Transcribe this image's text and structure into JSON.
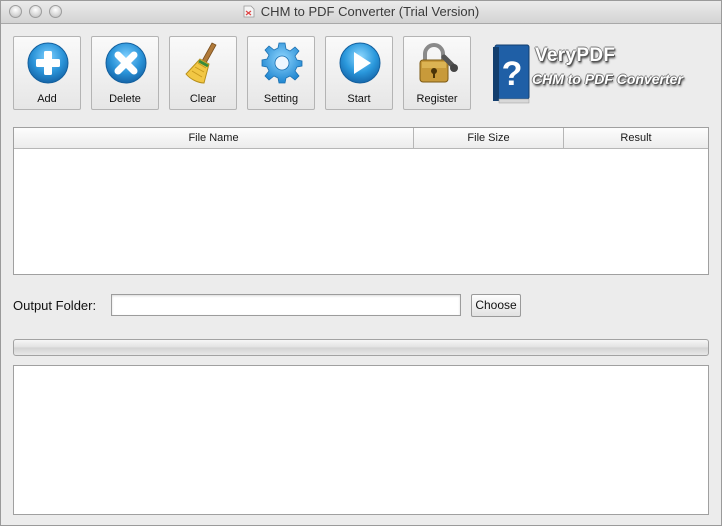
{
  "window": {
    "title": "CHM to PDF Converter (Trial Version)"
  },
  "toolbar": {
    "add_label": "Add",
    "delete_label": "Delete",
    "clear_label": "Clear",
    "setting_label": "Setting",
    "start_label": "Start",
    "register_label": "Register"
  },
  "logo": {
    "brand": "VeryPDF",
    "product": "CHM to PDF Converter"
  },
  "table": {
    "columns": [
      "File Name",
      "File Size",
      "Result"
    ],
    "rows": []
  },
  "output": {
    "label": "Output Folder:",
    "value": "",
    "choose_label": "Choose"
  },
  "progress": {
    "value": 0
  },
  "log": {
    "text": ""
  },
  "icons": {
    "add": "plus-circle-icon",
    "delete": "x-circle-icon",
    "clear": "broom-icon",
    "setting": "gear-icon",
    "start": "play-icon",
    "register": "padlock-key-icon"
  },
  "colors": {
    "accent_blue": "#2a93d8",
    "window_bg": "#ececec"
  }
}
